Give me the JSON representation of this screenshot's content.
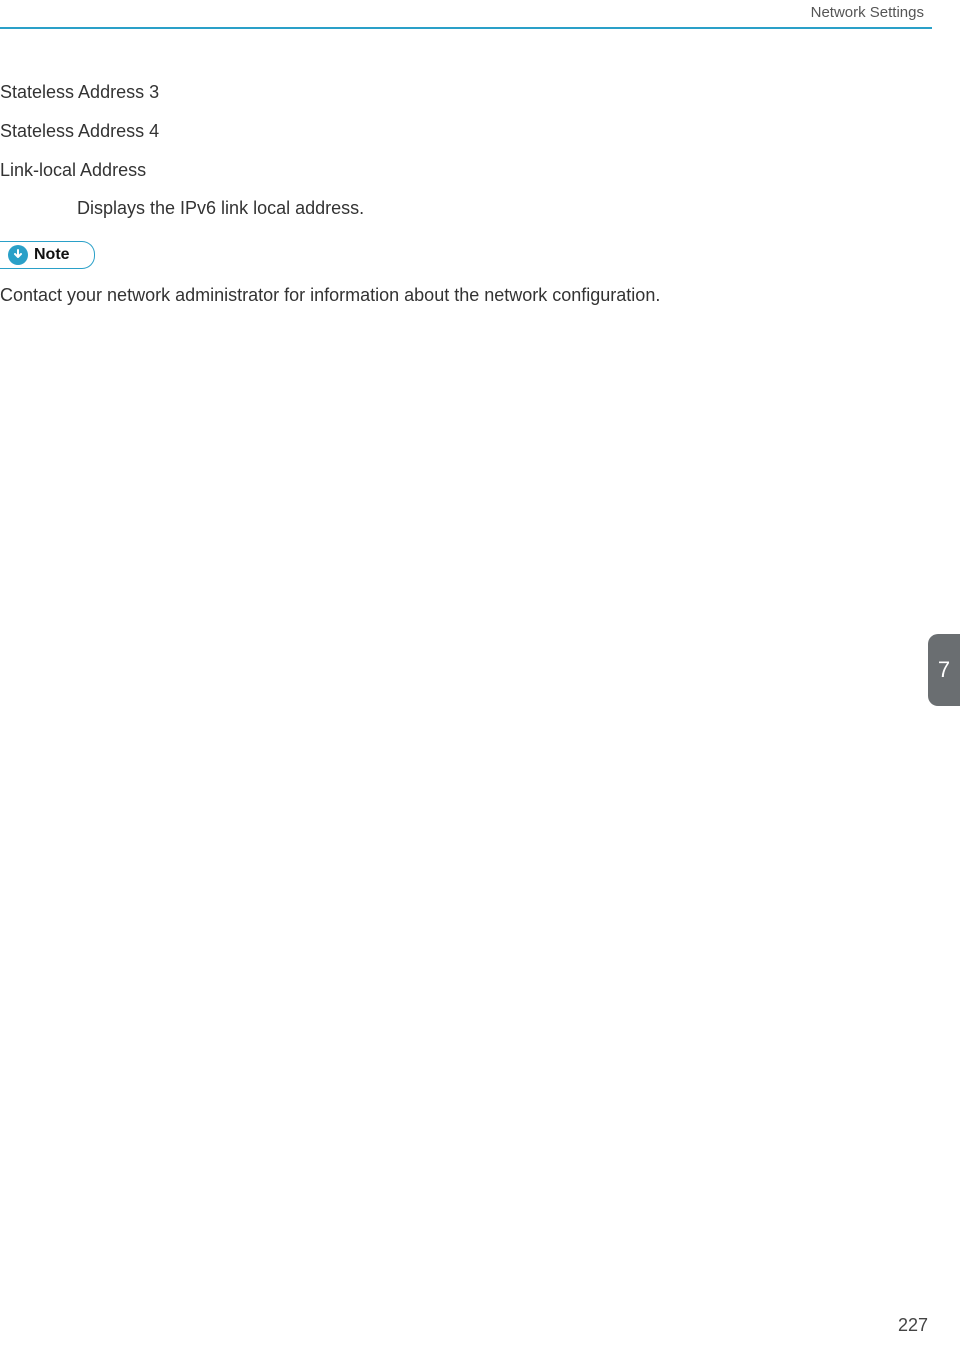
{
  "header": {
    "title": "Network Settings"
  },
  "content": {
    "sub_bullets": [
      "Stateless Address 3",
      "Stateless Address 4"
    ],
    "main_bullet": "Link-local Address",
    "main_desc": "Displays the IPv6 link local address.",
    "note_label": "Note",
    "note_items": [
      "Contact your network administrator for information about the network configuration."
    ]
  },
  "side_tab": "7",
  "page_number": "227"
}
